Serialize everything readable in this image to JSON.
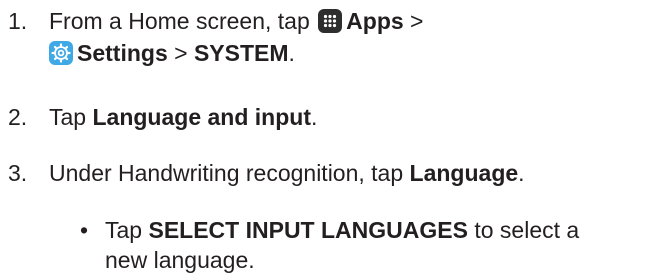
{
  "steps": [
    {
      "number": "1.",
      "line1": {
        "pre": "From a Home screen, tap",
        "apps_icon": "apps-grid-icon",
        "apps_label": "Apps",
        "sep": ">"
      },
      "line2": {
        "settings_icon": "settings-gear-icon",
        "settings_label": "Settings",
        "sep": ">",
        "system_label": "SYSTEM",
        "end": "."
      }
    },
    {
      "number": "2.",
      "pre": "Tap",
      "bold": "Language and input",
      "end": "."
    },
    {
      "number": "3.",
      "pre": "Under Handwriting recognition, tap",
      "bold": "Language",
      "end": "."
    }
  ],
  "bullet": {
    "pre": "Tap",
    "bold": "SELECT INPUT LANGUAGES",
    "post": "to select a",
    "line2": "new language."
  },
  "colors": {
    "text": "#231f20",
    "apps_icon_bg": "#2e2e2e",
    "settings_icon_bg": "#3fa9e6"
  }
}
